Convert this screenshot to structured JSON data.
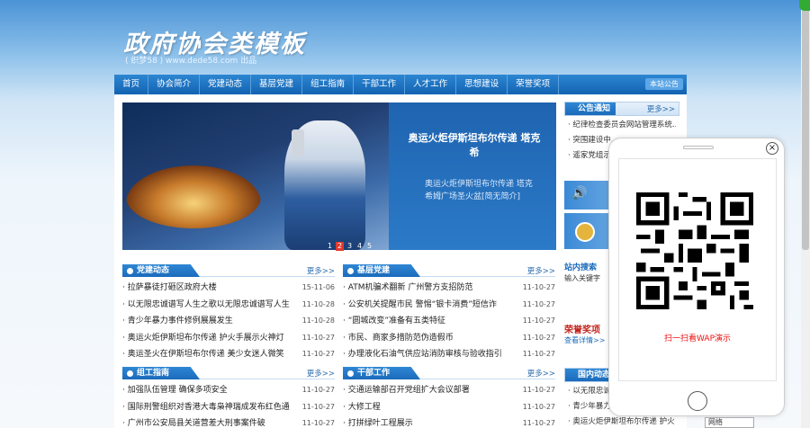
{
  "header": {
    "title": "政府协会类模板",
    "subtitle": "( 织梦58 ) www.dede58.com 出品"
  },
  "nav": {
    "items": [
      "首页",
      "协会简介",
      "党建动态",
      "基层党建",
      "组工指南",
      "干部工作",
      "人才工作",
      "思想建设",
      "荣誉奖项"
    ],
    "notice": "本站公告"
  },
  "banner": {
    "title": "奥运火炬伊斯坦布尔传递 塔克希",
    "desc": "奥运火炬伊斯坦布尔传递 塔克希姆广场圣火盆[简无简介]",
    "pages": [
      "1",
      "2",
      "3",
      "4",
      "5"
    ],
    "active_page": "2"
  },
  "boxes": {
    "party": {
      "title": "党建动态",
      "more": "更多>>",
      "items": [
        {
          "t": "拉萨暴徒打砸区政府大楼",
          "d": "15-11-06"
        },
        {
          "t": "以无限忠诚谱写人生之歌以无限忠诚谱写人生",
          "d": "11-10-28"
        },
        {
          "t": "青少年暴力事件修例展展发生",
          "d": "11-10-28"
        },
        {
          "t": "奥运火炬伊斯坦布尔传递 护火手展示火神灯",
          "d": "11-10-27"
        },
        {
          "t": "奥运圣火在伊斯坦布尔传递 美少女迷人微笑",
          "d": "11-10-27"
        }
      ]
    },
    "grassroots": {
      "title": "基层党建",
      "more": "更多>>",
      "items": [
        {
          "t": "ATM机骗术翻新 广州警方支招防范",
          "d": "11-10-27"
        },
        {
          "t": "公安机关提醒市民 警惕“银卡消费”短信诈",
          "d": "11-10-27"
        },
        {
          "t": "“圆城改变”准备有五类特征",
          "d": "11-10-27"
        },
        {
          "t": "市民、商家多措防范伪造假币",
          "d": "11-10-27"
        },
        {
          "t": "办理液化石油气供应站消防审核与验收指引",
          "d": "11-10-27"
        }
      ]
    },
    "org": {
      "title": "组工指南",
      "more": "更多>>",
      "items": [
        {
          "t": "加强队伍管理 确保多项安全",
          "d": "11-10-27"
        },
        {
          "t": "国际刑警组织对香港大毒枭神瑞成发布红色通",
          "d": "11-10-27"
        },
        {
          "t": "广州市公安局县关道营差大刑事案件破",
          "d": "11-10-27"
        }
      ]
    },
    "cadre": {
      "title": "干部工作",
      "more": "更多>>",
      "items": [
        {
          "t": "交通运输部召开党组扩大会议部署",
          "d": "11-10-27"
        },
        {
          "t": "大修工程",
          "d": "11-10-27"
        },
        {
          "t": "打拼绿叶工程展示",
          "d": "11-10-27"
        }
      ]
    }
  },
  "sidebar": {
    "notice": {
      "title": "公告通知",
      "more": "更多>>",
      "items": [
        "纪律检查委员会网站管理系统...",
        "突围建设中...",
        "遥家党组示..."
      ]
    },
    "search": {
      "title": "站内搜索",
      "placeholder": "输入关键字"
    },
    "honor": {
      "title": "荣誉奖项",
      "sub": "查看详情>>"
    },
    "domestic": {
      "title": "国内动态",
      "items": [
        "以无限忠诚...",
        "青少年暴力...",
        "奥运火炬伊斯坦布尔传递 护火"
      ]
    }
  },
  "qr_popup": {
    "caption": "扫一扫看WAP演示",
    "close": "×"
  },
  "footer": {
    "select": "网络"
  }
}
